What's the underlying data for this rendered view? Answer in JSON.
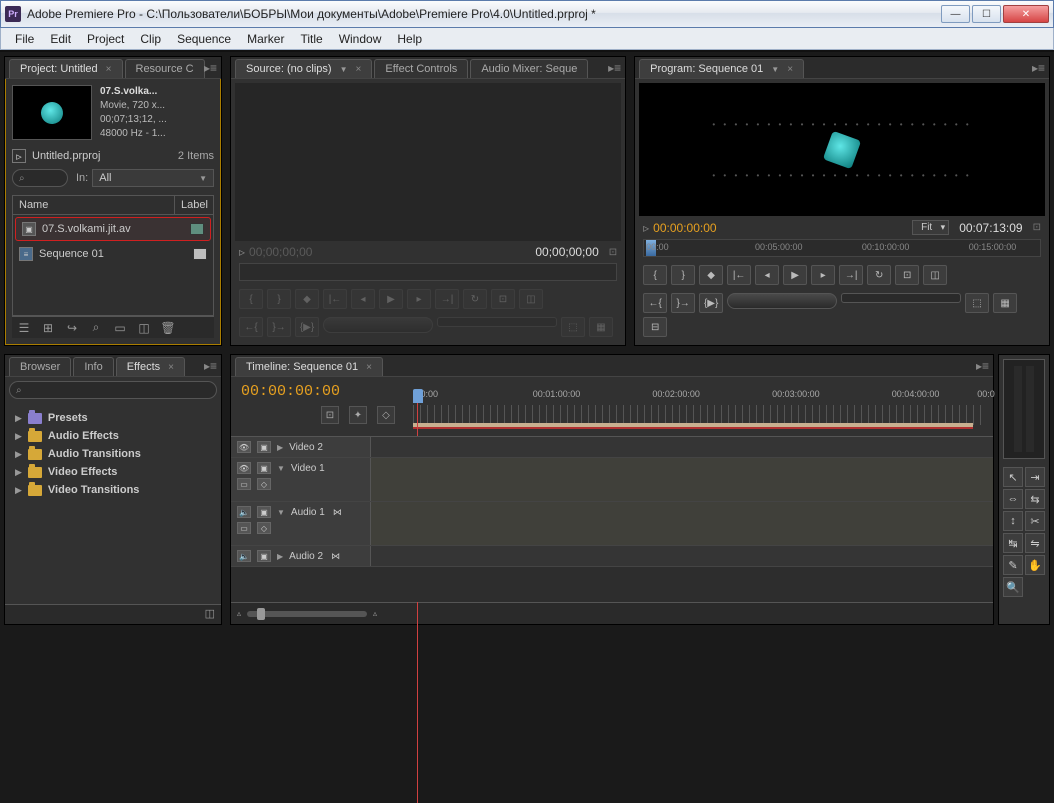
{
  "window": {
    "title": "Adobe Premiere Pro - C:\\Пользователи\\БОБРЫ\\Мои документы\\Adobe\\Premiere Pro\\4.0\\Untitled.prproj *",
    "app_badge": "Pr"
  },
  "menu": [
    "File",
    "Edit",
    "Project",
    "Clip",
    "Sequence",
    "Marker",
    "Title",
    "Window",
    "Help"
  ],
  "project_panel": {
    "tabs": [
      {
        "label": "Project: Untitled",
        "active": true
      },
      {
        "label": "Resource C",
        "active": false
      }
    ],
    "clip": {
      "name": "07.S.volka...",
      "line2": "Movie, 720 x...",
      "line3": "00;07;13;12, ...",
      "line4": "48000 Hz - 1..."
    },
    "project_name": "Untitled.prproj",
    "item_count": "2 Items",
    "in_label": "In:",
    "in_value": "All",
    "columns": {
      "name": "Name",
      "label": "Label"
    },
    "items": [
      {
        "name": "07.S.volkami.jit.av",
        "type": "clip",
        "selected": true
      },
      {
        "name": "Sequence 01",
        "type": "sequence",
        "selected": false
      }
    ]
  },
  "source_panel": {
    "tabs": [
      {
        "label": "Source: (no clips)",
        "active": true
      },
      {
        "label": "Effect Controls",
        "active": false
      },
      {
        "label": "Audio Mixer: Seque",
        "active": false
      }
    ],
    "tc_left": "00;00;00;00",
    "tc_right": "00;00;00;00"
  },
  "program_panel": {
    "tab": "Program: Sequence 01",
    "tc_left": "00:00:00:00",
    "fit": "Fit",
    "tc_right": "00:07:13:09",
    "ruler": [
      "00:00",
      "00:05:00:00",
      "00:10:00:00",
      "00:15:00:00"
    ]
  },
  "effects_panel": {
    "tabs": [
      {
        "label": "Browser"
      },
      {
        "label": "Info"
      },
      {
        "label": "Effects",
        "active": true
      }
    ],
    "items": [
      "Presets",
      "Audio Effects",
      "Audio Transitions",
      "Video Effects",
      "Video Transitions"
    ]
  },
  "timeline": {
    "tab": "Timeline: Sequence 01",
    "tc": "00:00:00:00",
    "ruler": [
      ":00:00",
      "00:01:00:00",
      "00:02:00:00",
      "00:03:00:00",
      "00:04:00:00",
      "00:0"
    ],
    "tracks": {
      "v2": "Video 2",
      "v1": "Video 1",
      "a1": "Audio 1",
      "a2": "Audio 2"
    }
  }
}
